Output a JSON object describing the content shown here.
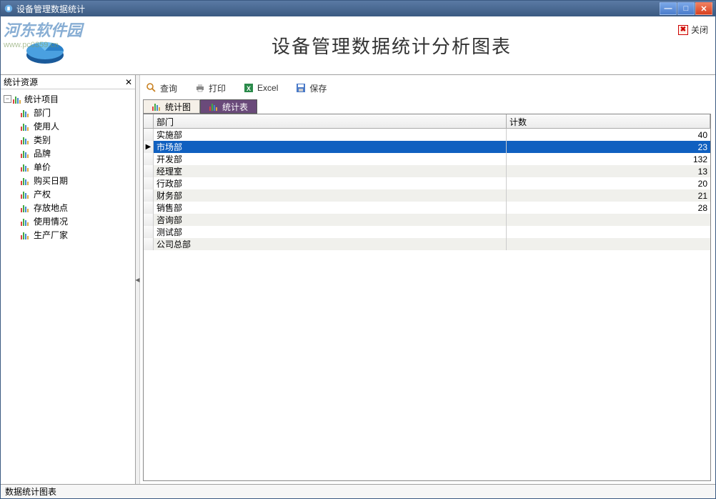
{
  "window": {
    "title": "设备管理数据统计"
  },
  "watermark": {
    "text": "河东软件园",
    "url": "www.pc0359.cn"
  },
  "header": {
    "page_title": "设备管理数据统计分析图表",
    "close_label": "关闭"
  },
  "sidebar": {
    "title": "统计资源",
    "root_label": "统计项目",
    "items": [
      {
        "label": "部门"
      },
      {
        "label": "使用人"
      },
      {
        "label": "类别"
      },
      {
        "label": "品牌"
      },
      {
        "label": "单价"
      },
      {
        "label": "购买日期"
      },
      {
        "label": "产权"
      },
      {
        "label": "存放地点"
      },
      {
        "label": "使用情况"
      },
      {
        "label": "生产厂家"
      }
    ]
  },
  "toolbar": {
    "query": "查询",
    "print": "打印",
    "excel": "Excel",
    "save": "保存"
  },
  "tabs": {
    "chart": "统计图",
    "table": "统计表"
  },
  "grid": {
    "columns": {
      "a": "部门",
      "b": "计数"
    },
    "rows": [
      {
        "dept": "实施部",
        "count": "40",
        "selected": false
      },
      {
        "dept": "市场部",
        "count": "23",
        "selected": true
      },
      {
        "dept": "开发部",
        "count": "132",
        "selected": false
      },
      {
        "dept": "经理室",
        "count": "13",
        "selected": false
      },
      {
        "dept": "行政部",
        "count": "20",
        "selected": false
      },
      {
        "dept": "财务部",
        "count": "21",
        "selected": false
      },
      {
        "dept": "销售部",
        "count": "28",
        "selected": false
      },
      {
        "dept": "咨询部",
        "count": "",
        "selected": false
      },
      {
        "dept": "测试部",
        "count": "",
        "selected": false
      },
      {
        "dept": "公司总部",
        "count": "",
        "selected": false
      }
    ]
  },
  "statusbar": {
    "text": "数据统计图表"
  }
}
